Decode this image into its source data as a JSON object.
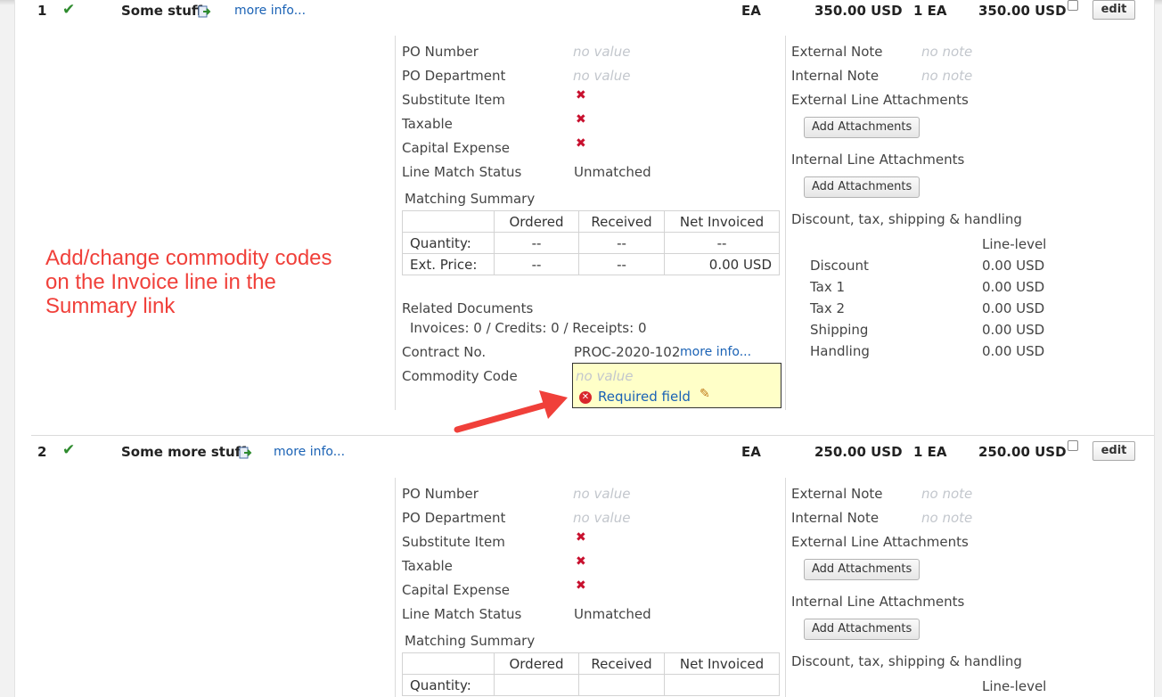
{
  "annotation": "Add/change commodity codes on the Invoice line in the Summary link",
  "lines": [
    {
      "num": "1",
      "name": "Some stuff",
      "more_info": "more info...",
      "uom": "EA",
      "unit_price": "350.00 USD",
      "qty": "1 EA",
      "extended": "350.00 USD",
      "edit": "edit"
    },
    {
      "num": "2",
      "name": "Some more stuff",
      "more_info": "more info...",
      "uom": "EA",
      "unit_price": "250.00 USD",
      "qty": "1 EA",
      "extended": "250.00 USD",
      "edit": "edit"
    }
  ],
  "labels": {
    "po_number": "PO Number",
    "po_department": "PO Department",
    "substitute_item": "Substitute Item",
    "taxable": "Taxable",
    "capital_expense": "Capital Expense",
    "line_match_status": "Line Match Status",
    "unmatched": "Unmatched",
    "matching_summary": "Matching Summary",
    "no_value": "no value",
    "related_documents": "Related Documents",
    "related_counts": "Invoices: 0 / Credits: 0 / Receipts: 0",
    "contract_no": "Contract No.",
    "contract_value": "PROC-2020-102",
    "more_info": "more info...",
    "commodity_code": "Commodity Code",
    "required_field": "Required field",
    "external_note": "External Note",
    "internal_note": "Internal Note",
    "no_note": "no note",
    "external_line_attachments": "External Line Attachments",
    "internal_line_attachments": "Internal Line Attachments",
    "add_attachments": "Add Attachments",
    "discount_header": "Discount, tax, shipping & handling",
    "line_level": "Line-level"
  },
  "matching": {
    "headers": [
      "Ordered",
      "Received",
      "Net Invoiced"
    ],
    "rows": [
      {
        "label": "Quantity:",
        "ordered": "--",
        "received": "--",
        "net": "--"
      },
      {
        "label": "Ext. Price:",
        "ordered": "--",
        "received": "--",
        "net": "0.00 USD"
      }
    ]
  },
  "charges": [
    {
      "label": "Discount",
      "value": "0.00 USD"
    },
    {
      "label": "Tax 1",
      "value": "0.00 USD"
    },
    {
      "label": "Tax 2",
      "value": "0.00 USD"
    },
    {
      "label": "Shipping",
      "value": "0.00 USD"
    },
    {
      "label": "Handling",
      "value": "0.00 USD"
    }
  ],
  "colors": {
    "accent_red": "#f0403a",
    "link_blue": "#1a62b5",
    "check_green": "#2e8b2e",
    "required_bg": "#ffffc8"
  }
}
